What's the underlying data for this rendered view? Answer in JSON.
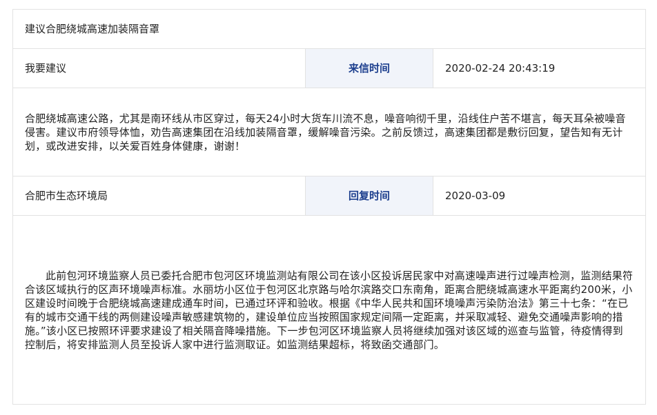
{
  "letter": {
    "title": "建议合肥绕城高速加装隔音罩",
    "type": "我要建议",
    "sent_label": "来信时间",
    "sent_time": "2020-02-24 20:43:19",
    "content": "合肥绕城高速公路，尤其是南环线从市区穿过，每天24小时大货车川流不息，噪音响彻千里，沿线住户苦不堪言，每天耳朵被噪音侵害。建议市府领导体恤，劝告高速集团在沿线加装隔音罩，缓解噪音污染。之前反馈过，高速集团都是敷衍回复，望告知有无计划，或改进安排，以关爱百姓身体健康，谢谢！"
  },
  "reply": {
    "department": "合肥市生态环境局",
    "reply_label": "回复时间",
    "reply_time": "2020-03-09",
    "content": "此前包河环境监察人员已委托合肥市包河区环境监测站有限公司在该小区投诉居民家中对高速噪声进行过噪声检测，监测结果符合该区域执行的区声环境噪声标准。水丽坊小区位于包河区北京路与哈尔滨路交口东南角，距离合肥绕城高速水平距离约200米，小区建设时间晚于合肥绕城高速建成通车时间，已通过环评和验收。根据《中华人民共和国环境噪声污染防治法》第三十七条：“在已有的城市交通干线的两侧建设噪声敏感建筑物的，建设单位应当按照国家规定间隔一定距离，并采取减轻、避免交通噪声影响的措施。”该小区已按照环评要求建设了相关隔音降噪措施。下一步包河区环境监察人员将继续加强对该区域的巡查与监管，待疫情得到控制后，将安排监测人员至投诉人家中进行监测取证。如监测结果超标，将致函交通部门。"
  }
}
